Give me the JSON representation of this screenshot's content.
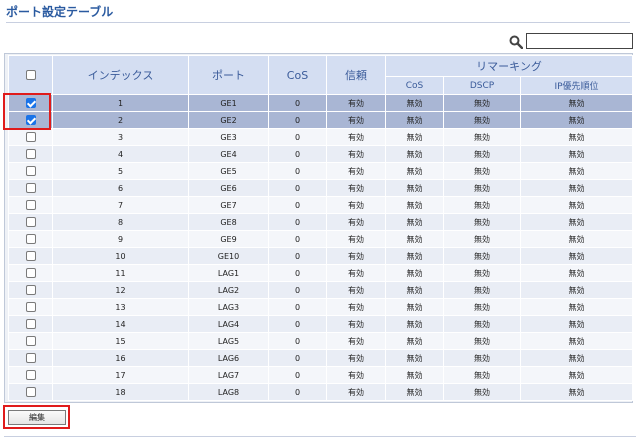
{
  "page": {
    "title": "ポート設定テーブル"
  },
  "search": {
    "value": ""
  },
  "table": {
    "header": {
      "index": "インデックス",
      "port": "ポート",
      "cos": "CoS",
      "trust": "信頼",
      "remarking": "リマーキング",
      "remark_cos": "CoS",
      "remark_dscp": "DSCP",
      "remark_ip": "IP優先順位"
    },
    "rows": [
      {
        "index": "1",
        "port": "GE1",
        "cos": "0",
        "trust": "有効",
        "rcos": "無効",
        "dscp": "無効",
        "ip": "無効",
        "checked": true
      },
      {
        "index": "2",
        "port": "GE2",
        "cos": "0",
        "trust": "有効",
        "rcos": "無効",
        "dscp": "無効",
        "ip": "無効",
        "checked": true
      },
      {
        "index": "3",
        "port": "GE3",
        "cos": "0",
        "trust": "有効",
        "rcos": "無効",
        "dscp": "無効",
        "ip": "無効",
        "checked": false
      },
      {
        "index": "4",
        "port": "GE4",
        "cos": "0",
        "trust": "有効",
        "rcos": "無効",
        "dscp": "無効",
        "ip": "無効",
        "checked": false
      },
      {
        "index": "5",
        "port": "GE5",
        "cos": "0",
        "trust": "有効",
        "rcos": "無効",
        "dscp": "無効",
        "ip": "無効",
        "checked": false
      },
      {
        "index": "6",
        "port": "GE6",
        "cos": "0",
        "trust": "有効",
        "rcos": "無効",
        "dscp": "無効",
        "ip": "無効",
        "checked": false
      },
      {
        "index": "7",
        "port": "GE7",
        "cos": "0",
        "trust": "有効",
        "rcos": "無効",
        "dscp": "無効",
        "ip": "無効",
        "checked": false
      },
      {
        "index": "8",
        "port": "GE8",
        "cos": "0",
        "trust": "有効",
        "rcos": "無効",
        "dscp": "無効",
        "ip": "無効",
        "checked": false
      },
      {
        "index": "9",
        "port": "GE9",
        "cos": "0",
        "trust": "有効",
        "rcos": "無効",
        "dscp": "無効",
        "ip": "無効",
        "checked": false
      },
      {
        "index": "10",
        "port": "GE10",
        "cos": "0",
        "trust": "有効",
        "rcos": "無効",
        "dscp": "無効",
        "ip": "無効",
        "checked": false
      },
      {
        "index": "11",
        "port": "LAG1",
        "cos": "0",
        "trust": "有効",
        "rcos": "無効",
        "dscp": "無効",
        "ip": "無効",
        "checked": false
      },
      {
        "index": "12",
        "port": "LAG2",
        "cos": "0",
        "trust": "有効",
        "rcos": "無効",
        "dscp": "無効",
        "ip": "無効",
        "checked": false
      },
      {
        "index": "13",
        "port": "LAG3",
        "cos": "0",
        "trust": "有効",
        "rcos": "無効",
        "dscp": "無効",
        "ip": "無効",
        "checked": false
      },
      {
        "index": "14",
        "port": "LAG4",
        "cos": "0",
        "trust": "有効",
        "rcos": "無効",
        "dscp": "無効",
        "ip": "無効",
        "checked": false
      },
      {
        "index": "15",
        "port": "LAG5",
        "cos": "0",
        "trust": "有効",
        "rcos": "無効",
        "dscp": "無効",
        "ip": "無効",
        "checked": false
      },
      {
        "index": "16",
        "port": "LAG6",
        "cos": "0",
        "trust": "有効",
        "rcos": "無効",
        "dscp": "無効",
        "ip": "無効",
        "checked": false
      },
      {
        "index": "17",
        "port": "LAG7",
        "cos": "0",
        "trust": "有効",
        "rcos": "無効",
        "dscp": "無効",
        "ip": "無効",
        "checked": false
      },
      {
        "index": "18",
        "port": "LAG8",
        "cos": "0",
        "trust": "有効",
        "rcos": "無効",
        "dscp": "無効",
        "ip": "無効",
        "checked": false
      }
    ]
  },
  "actions": {
    "edit_label": "編集"
  },
  "colors": {
    "title": "#2a5aa0",
    "header_bg": "#d4def2",
    "selected_row": "#a9b6d4",
    "highlight_box": "#e01b1b",
    "checkbox_on": "#1a73e8"
  },
  "icons": {
    "search": "search-icon"
  }
}
